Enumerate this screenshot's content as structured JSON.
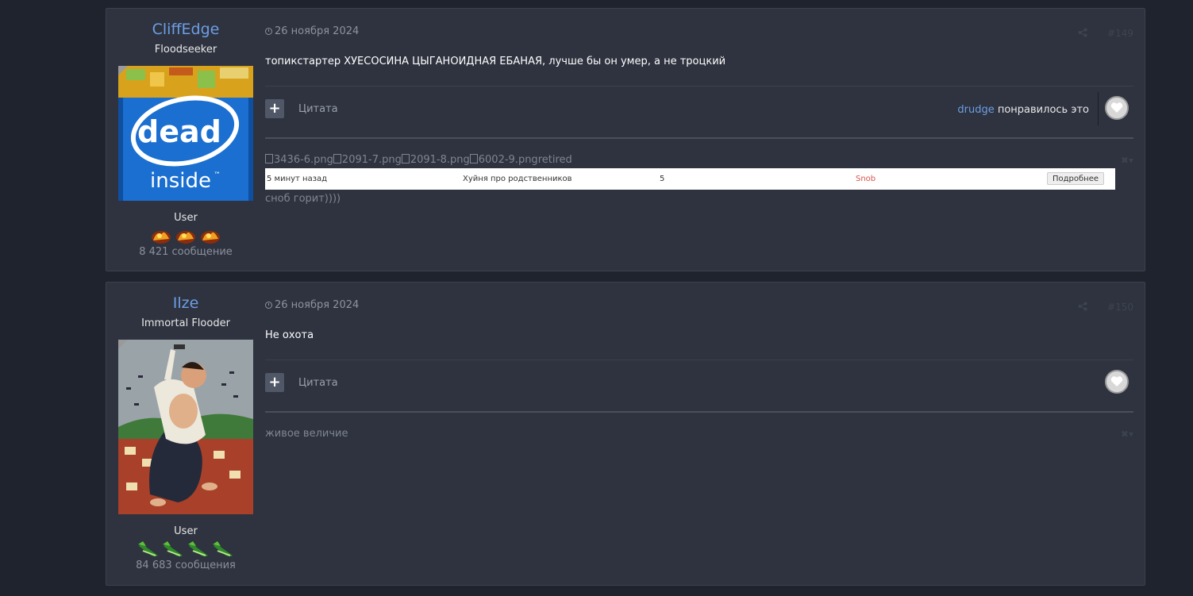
{
  "posts": [
    {
      "author": "CliffEdge",
      "title": "Floodseeker",
      "group": "User",
      "count": "8 421 сообщение",
      "badge_count": 3,
      "date": "26 ноября 2024",
      "number": "#149",
      "text": "топикстартер ХУЕСОСИНА ЦЫГАНОИДНАЯ ЕБАНАЯ, лучше бы он умер, а не троцкий",
      "quote_label": "Цитата",
      "like_user": "drudge",
      "like_text": " понравилось это",
      "avatar": {
        "line1": "dead",
        "line2": "inside",
        "tm": "™"
      },
      "signature": {
        "images": [
          "3436-6.png",
          "2091-7.png",
          "2091-8.png",
          "6002-9.png"
        ],
        "images_suffix": "retired",
        "row": {
          "time": "5 минут назад",
          "topic": "Хуйня про родственников",
          "replies": "5",
          "user": "Snob",
          "button": "Подробнее"
        },
        "text": "сноб горит))))"
      }
    },
    {
      "author": "Ilze",
      "title": "Immortal Flooder",
      "group": "User",
      "count": "84 683 сообщения",
      "badge_count": 4,
      "date": "26 ноября 2024",
      "number": "#150",
      "text": "Не охота",
      "quote_label": "Цитата",
      "signature": {
        "text": "живое величие"
      }
    }
  ],
  "colors": {
    "background": "#1f232d",
    "panel": "#2e333f",
    "author_link": "#6d9ee5",
    "intel_blue": "#1a6fd0",
    "snob_red": "#d9534f"
  },
  "icons": [
    "clock-icon",
    "share-icon",
    "plus-icon",
    "heart-icon",
    "close-icon",
    "chevron-down-icon"
  ]
}
